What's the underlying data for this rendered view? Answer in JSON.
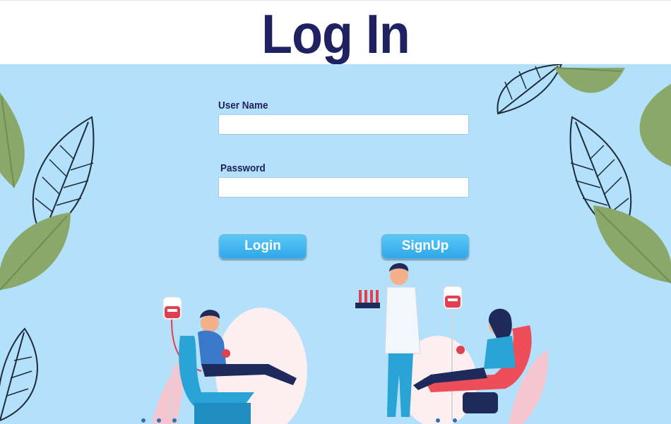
{
  "header": {
    "title": "Log In"
  },
  "form": {
    "username_label": "User Name",
    "username_value": "",
    "password_label": "Password",
    "password_value": "",
    "login_label": "Login",
    "signup_label": "SignUp"
  },
  "colors": {
    "title": "#1f2163",
    "background": "#b3e0fb",
    "button": "#2fa7ea",
    "leaf_green": "#8aa86a",
    "leaf_outline": "#1e2b3a"
  },
  "illustration": {
    "description_icons": [
      "leaf-icon",
      "blood-bag-icon",
      "donor-chair-icon",
      "doctor-icon"
    ]
  }
}
